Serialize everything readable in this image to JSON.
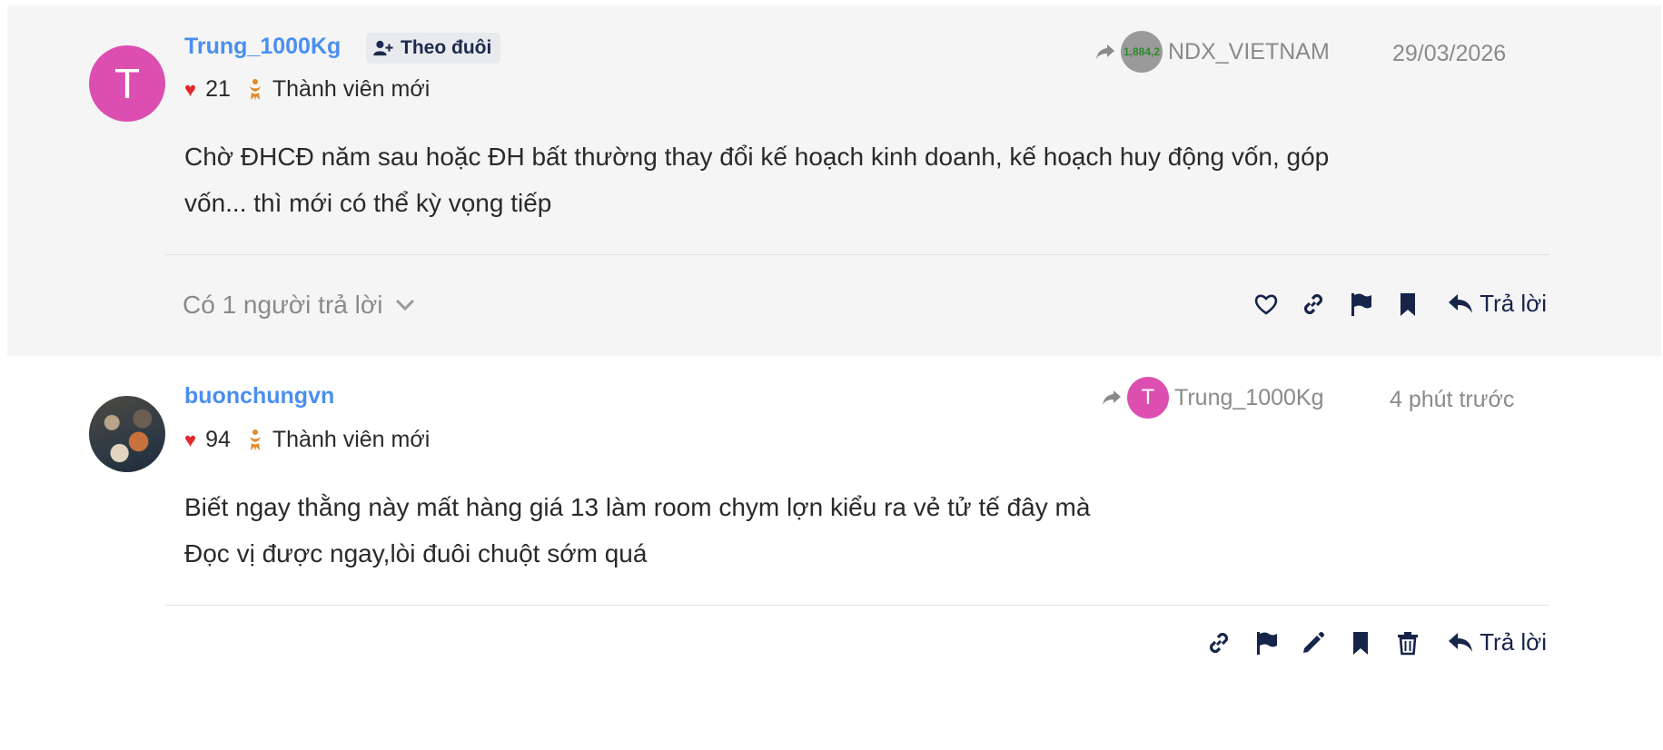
{
  "comments": [
    {
      "avatar_letter": "T",
      "username": "Trung_1000Kg",
      "follow_label": "Theo đuôi",
      "likes": "21",
      "badge": "Thành viên mới",
      "reply_to_name": "NDX_VIETNAM",
      "reply_to_avatar_text": "1,884,2",
      "date": "29/03/2026",
      "body_line1": "Chờ ĐHCĐ năm sau hoặc ĐH bất thường thay đổi kế hoạch kinh doanh, kế hoạch huy động vốn, góp",
      "body_line2": "vốn... thì mới có thể kỳ vọng tiếp",
      "replies_label": "Có 1 người trả lời",
      "reply_label": "Trả lời"
    },
    {
      "username": "buonchungvn",
      "likes": "94",
      "badge": "Thành viên mới",
      "reply_to_name": "Trung_1000Kg",
      "reply_to_avatar_letter": "T",
      "date": "4 phút trước",
      "body_line1": "Biết ngay thằng này mất hàng giá 13 làm room chym lợn kiểu ra vẻ tử tế đây mà",
      "body_line2": "Đọc vị được ngay,lòi đuôi chuột sớm quá",
      "reply_label": "Trả lời"
    }
  ],
  "colors": {
    "username": "#4a8ff0",
    "avatar_pink": "#dc4fb0",
    "heart": "#e3282e",
    "action_icons": "#16244a",
    "muted_text": "#8a8a8a"
  }
}
